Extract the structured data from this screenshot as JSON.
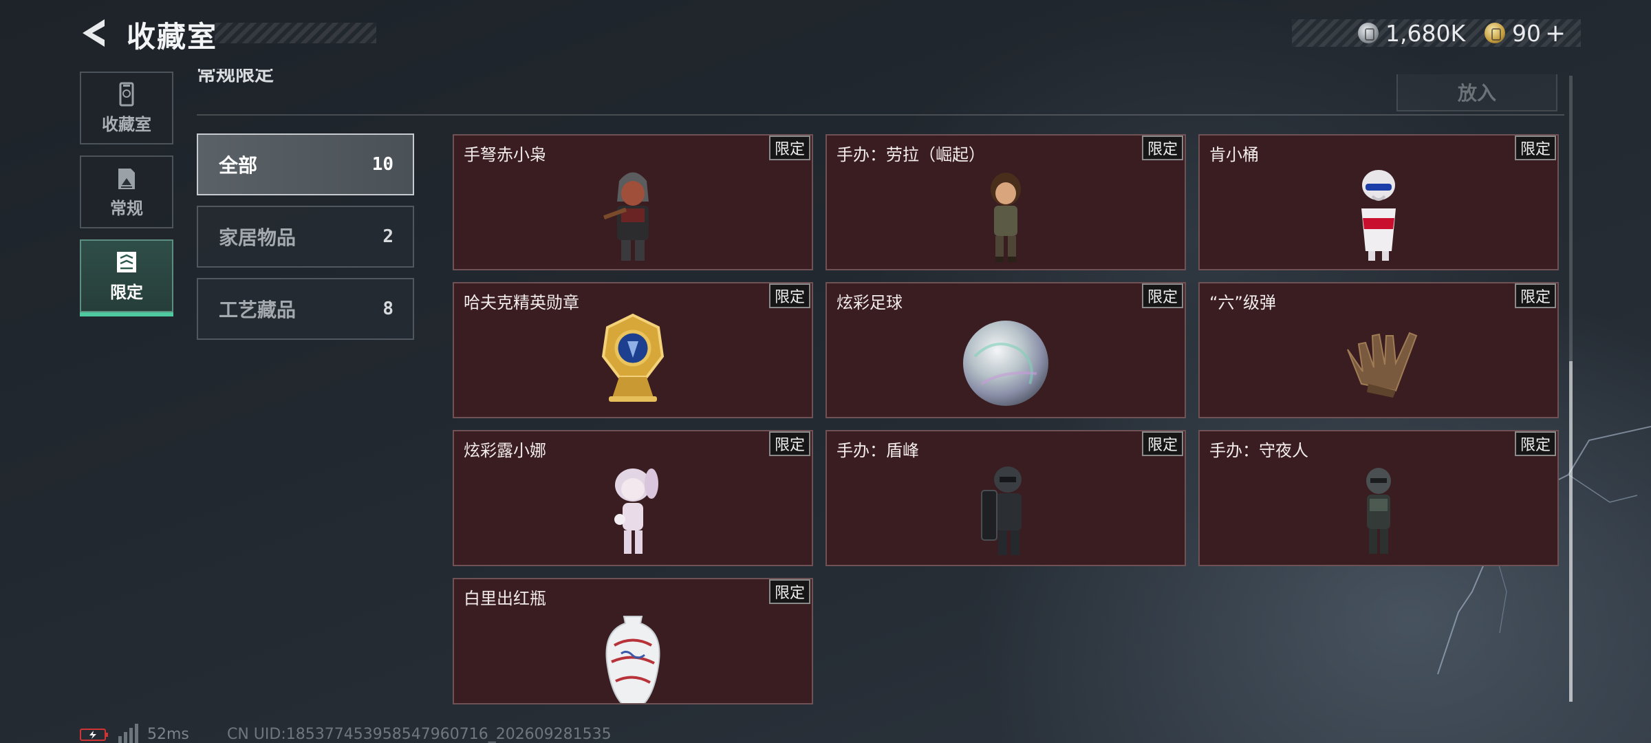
{
  "header": {
    "title": "收藏室",
    "currencies": [
      {
        "icon": "silver-coin-icon",
        "value": "1,680K"
      },
      {
        "icon": "gold-coin-icon",
        "value": "90"
      }
    ],
    "plus": "+"
  },
  "sidebar": {
    "items": [
      {
        "label": "收藏室",
        "icon": "trophy-cabinet-icon",
        "active": false
      },
      {
        "label": "常规",
        "icon": "document-icon",
        "active": false
      },
      {
        "label": "限定",
        "icon": "limited-card-icon",
        "active": true
      }
    ]
  },
  "section": {
    "title": "常规限定",
    "put_in_label": "放入"
  },
  "filters": [
    {
      "label": "全部",
      "count": "10",
      "active": true
    },
    {
      "label": "家居物品",
      "count": "2",
      "active": false
    },
    {
      "label": "工艺藏品",
      "count": "8",
      "active": false
    }
  ],
  "items": [
    {
      "name": "手弩赤小枭",
      "tag": "限定",
      "icon": "hooded-crossbow-figure-icon"
    },
    {
      "name": "手办：劳拉（崛起）",
      "tag": "限定",
      "icon": "explorer-figure-icon"
    },
    {
      "name": "肯小桶",
      "tag": "限定",
      "icon": "bucket-mascot-figure-icon"
    },
    {
      "name": "哈夫克精英勋章",
      "tag": "限定",
      "icon": "gold-medal-trophy-icon"
    },
    {
      "name": "炫彩足球",
      "tag": "限定",
      "icon": "iridescent-ball-icon"
    },
    {
      "name": "“六”级弹",
      "tag": "限定",
      "icon": "bronze-hand-sculpture-icon"
    },
    {
      "name": "炫彩露小娜",
      "tag": "限定",
      "icon": "pastel-girl-figure-icon"
    },
    {
      "name": "手办：盾峰",
      "tag": "限定",
      "icon": "shield-soldier-figure-icon"
    },
    {
      "name": "手办：守夜人",
      "tag": "限定",
      "icon": "armored-soldier-figure-icon"
    },
    {
      "name": "白里出红瓶",
      "tag": "限定",
      "icon": "porcelain-vase-icon"
    }
  ],
  "footer": {
    "ping": "52ms",
    "uid": "CN UID:18537745395854796071​6_202609281535"
  },
  "colors": {
    "accent": "#4fc9a0",
    "card_bg": "#3a1d21",
    "card_border": "#6e5256"
  }
}
